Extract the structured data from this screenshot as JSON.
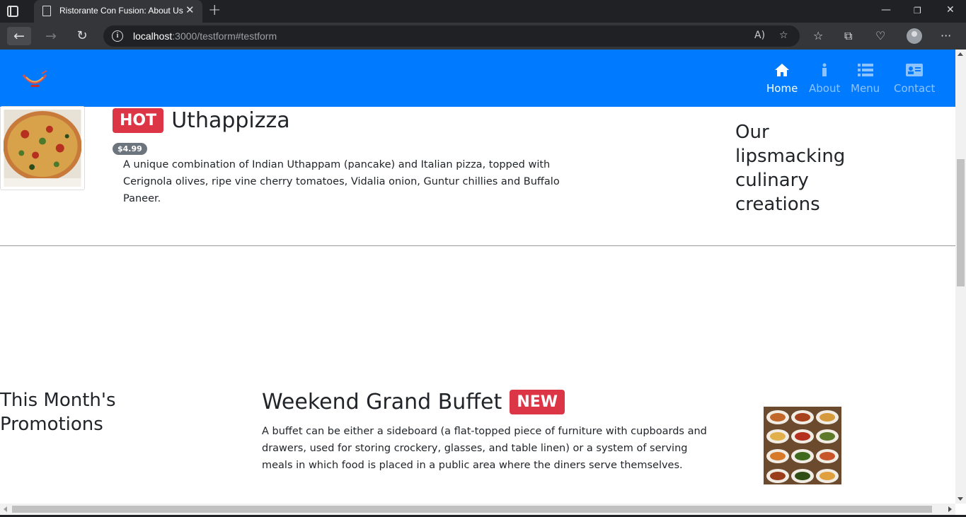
{
  "browser": {
    "tab_title": "Ristorante Con Fusion: About Us",
    "url_host": "localhost",
    "url_rest": ":3000/testform#testform"
  },
  "navbar": {
    "items": [
      {
        "label": "Home",
        "icon": "home-icon",
        "active": true
      },
      {
        "label": "About",
        "icon": "info-icon",
        "active": false
      },
      {
        "label": "Menu",
        "icon": "list-icon",
        "active": false
      },
      {
        "label": "Contact",
        "icon": "address-card-icon",
        "active": false
      }
    ]
  },
  "featured": {
    "badge": "HOT",
    "name": "Uthappizza",
    "price": "$4.99",
    "description": "A unique combination of Indian Uthappam (pancake) and Italian pizza, topped with Cerignola olives, ripe vine cherry tomatoes, Vidalia onion, Guntur chillies and Buffalo Paneer.",
    "side_heading": "Our lipsmacking culinary creations"
  },
  "promotion": {
    "heading": "This Month's Promotions",
    "name": "Weekend Grand Buffet",
    "badge": "NEW",
    "description": "A buffet can be either a sideboard (a flat-topped piece of furniture with cupboards and drawers, used for storing crockery, glasses, and table linen) or a system of serving meals in which food is placed in a public area where the diners serve themselves."
  },
  "colors": {
    "navbar": "#007bff",
    "badge_danger": "#dc3545",
    "badge_secondary": "#6c757d"
  }
}
